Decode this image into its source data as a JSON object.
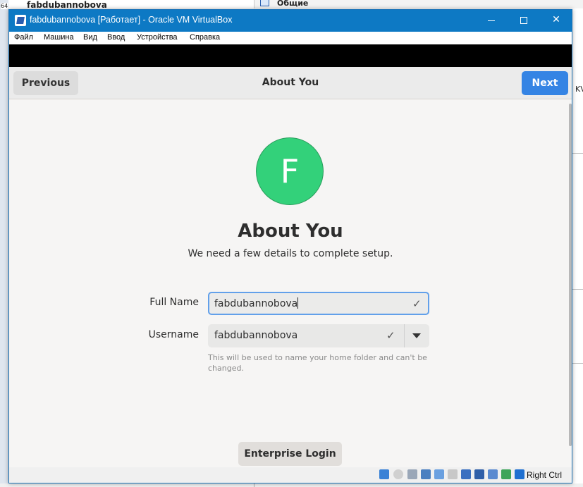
{
  "background": {
    "host_title": "fabdubannobova",
    "host_badge": "64",
    "right_label": "Общие",
    "right_edge_text": "KV"
  },
  "window": {
    "title": "fabdubannobova [Работает] - Oracle VM VirtualBox",
    "minimize": "",
    "maximize": "",
    "close": "✕"
  },
  "menu": {
    "items": [
      "Файл",
      "Машина",
      "Вид",
      "Ввод",
      "Устройства",
      "Справка"
    ]
  },
  "header": {
    "previous": "Previous",
    "title": "About You",
    "next": "Next"
  },
  "main": {
    "avatar_letter": "F",
    "heading": "About You",
    "subtitle": "We need a few details to complete setup.",
    "full_name_label": "Full Name",
    "full_name_value": "fabdubannobova",
    "username_label": "Username",
    "username_value": "fabdubannobova",
    "check": "✓",
    "hint": "This will be used to name your home folder and can't be changed.",
    "enterprise_login": "Enterprise Login"
  },
  "statusbar": {
    "host_key": "Right Ctrl",
    "icons": [
      "disk-icon",
      "optical-icon",
      "audio-icon",
      "network-icon",
      "usb-icon",
      "shared-folder-icon",
      "display-icon",
      "recording-icon",
      "cpu-icon",
      "virtualization-icon",
      "mouse-integration-icon",
      "keyboard-icon"
    ],
    "colors": {
      "accent": "#3584e4",
      "titlebar": "#0d79c4",
      "avatar": "#33d17a"
    }
  }
}
